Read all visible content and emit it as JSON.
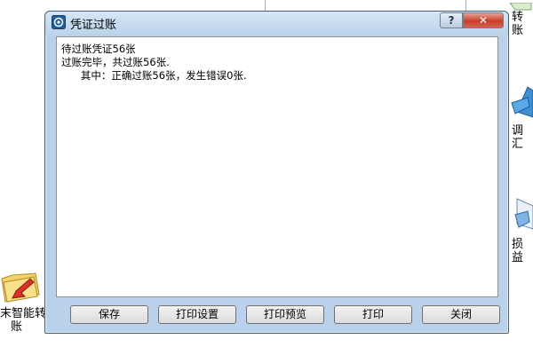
{
  "dialog": {
    "title": "凭证过账",
    "help_symbol": "?",
    "close_symbol": "✕",
    "log_lines": [
      "待过账凭证56张",
      "过账完毕，共过账56张.",
      "      其中：正确过账56张，发生错误0张."
    ],
    "buttons": {
      "save": "保存",
      "print_settings": "打印设置",
      "print_preview": "打印预览",
      "print": "打印",
      "close": "关闭"
    }
  },
  "desktop": {
    "icon_left_label_line1": "末智能转",
    "icon_left_label_line2": "账",
    "right_label_top": "转账",
    "right_label_mid": "调汇",
    "right_label_bottom": "损益"
  }
}
